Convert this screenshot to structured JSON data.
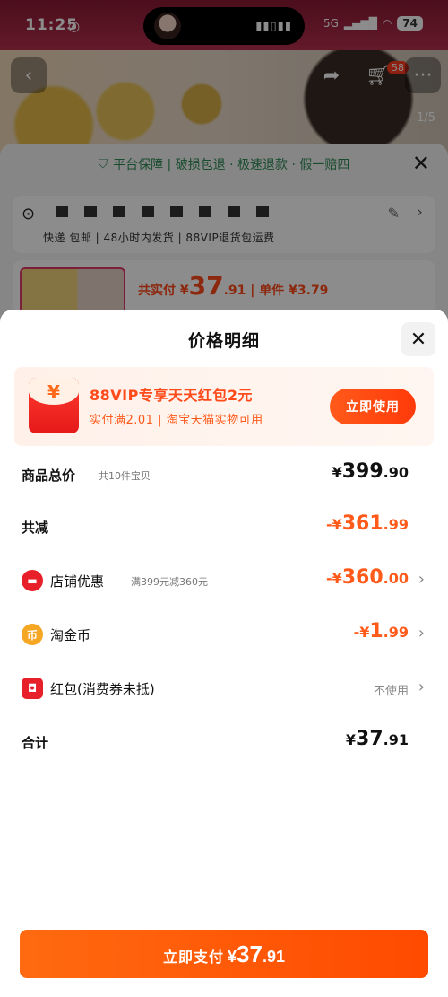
{
  "status_bar": {
    "time": "11:25",
    "network": "5G",
    "battery": "74"
  },
  "header": {
    "cart_badge": "58",
    "image_index": "1/5"
  },
  "guarantee": {
    "text": "平台保障 | 破损包退 · 极速退款 · 假一赔四"
  },
  "address": {
    "tags": "快递 包邮 | 48小时内发货 | 88VIP退货包运费"
  },
  "product": {
    "price_prefix": "共实付 ¥",
    "price_int": "37",
    "price_dec": ".91",
    "unit_price": "| 单件 ¥3.79"
  },
  "sheet": {
    "title": "价格明细",
    "promo": {
      "title": "88VIP专享天天红包2元",
      "subtitle": "实付满2.01 | 淘宝天猫实物可用",
      "button": "立即使用"
    },
    "rows": {
      "total": {
        "label": "商品总价",
        "sub": "共10件宝贝",
        "cur": "¥",
        "int": "399",
        "dec": ".90"
      },
      "reduced": {
        "label": "共减",
        "cur": "-¥",
        "int": "361",
        "dec": ".99"
      },
      "shop": {
        "label": "店铺优惠",
        "sub": "满399元减360元",
        "cur": "-¥",
        "int": "360",
        "dec": ".00"
      },
      "coins": {
        "label": "淘金币",
        "cur": "-¥",
        "int": "1",
        "dec": ".99"
      },
      "redpacket": {
        "label": "红包(消费券未抵)",
        "value": "不使用"
      },
      "sum": {
        "label": "合计",
        "cur": "¥",
        "int": "37",
        "dec": ".91"
      }
    },
    "pay_button": {
      "label": "立即支付",
      "cur": "¥",
      "int": "37",
      "dec": ".91"
    }
  },
  "colors": {
    "accent": "#ff5a1a",
    "guarantee_green": "#2e8b57",
    "promo_bg": "#fff1ea"
  },
  "icons": [
    "back-icon",
    "share-icon",
    "cart-icon",
    "more-icon",
    "shield-check-icon",
    "close-icon",
    "location-pin-icon",
    "edit-icon",
    "chevron-right-icon",
    "red-envelope-icon",
    "shop-icon",
    "coin-icon"
  ]
}
